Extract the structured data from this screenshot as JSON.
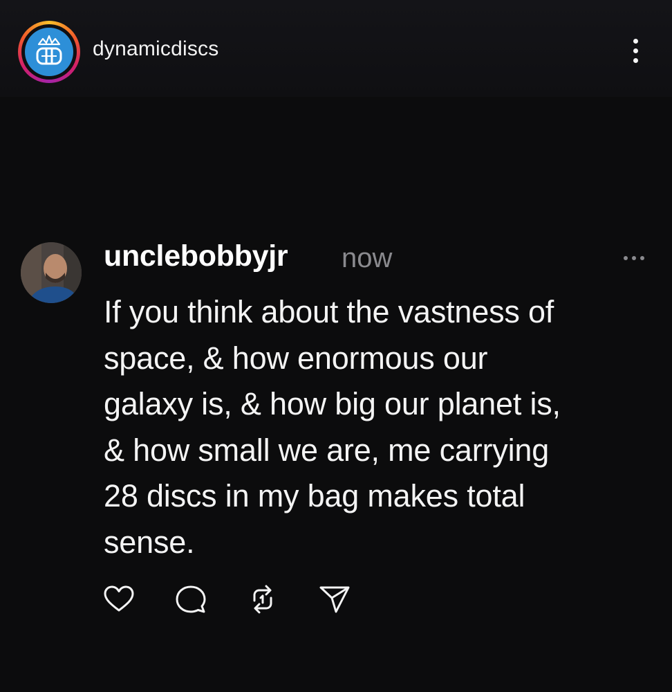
{
  "header": {
    "account_name": "dynamicdiscs",
    "logo_icon": "dynamic-discs-logo",
    "menu_icon": "vertical-ellipsis-icon"
  },
  "post": {
    "username": "unclebobbyjr",
    "timestamp": "now",
    "text": "If you think about the vastness of\nspace, & how enormous our\ngalaxy is, & how big our planet is,\n& how small we are, me carrying\n28 discs in my bag makes total\nsense.",
    "more_icon": "horizontal-ellipsis-icon",
    "actions": [
      "heart-icon",
      "comment-icon",
      "repost-icon",
      "share-icon"
    ]
  },
  "colors": {
    "background": "#0c0c0d",
    "text": "#f4f4f4",
    "muted": "#8a8a8e",
    "brand_blue": "#2d8fd8"
  }
}
